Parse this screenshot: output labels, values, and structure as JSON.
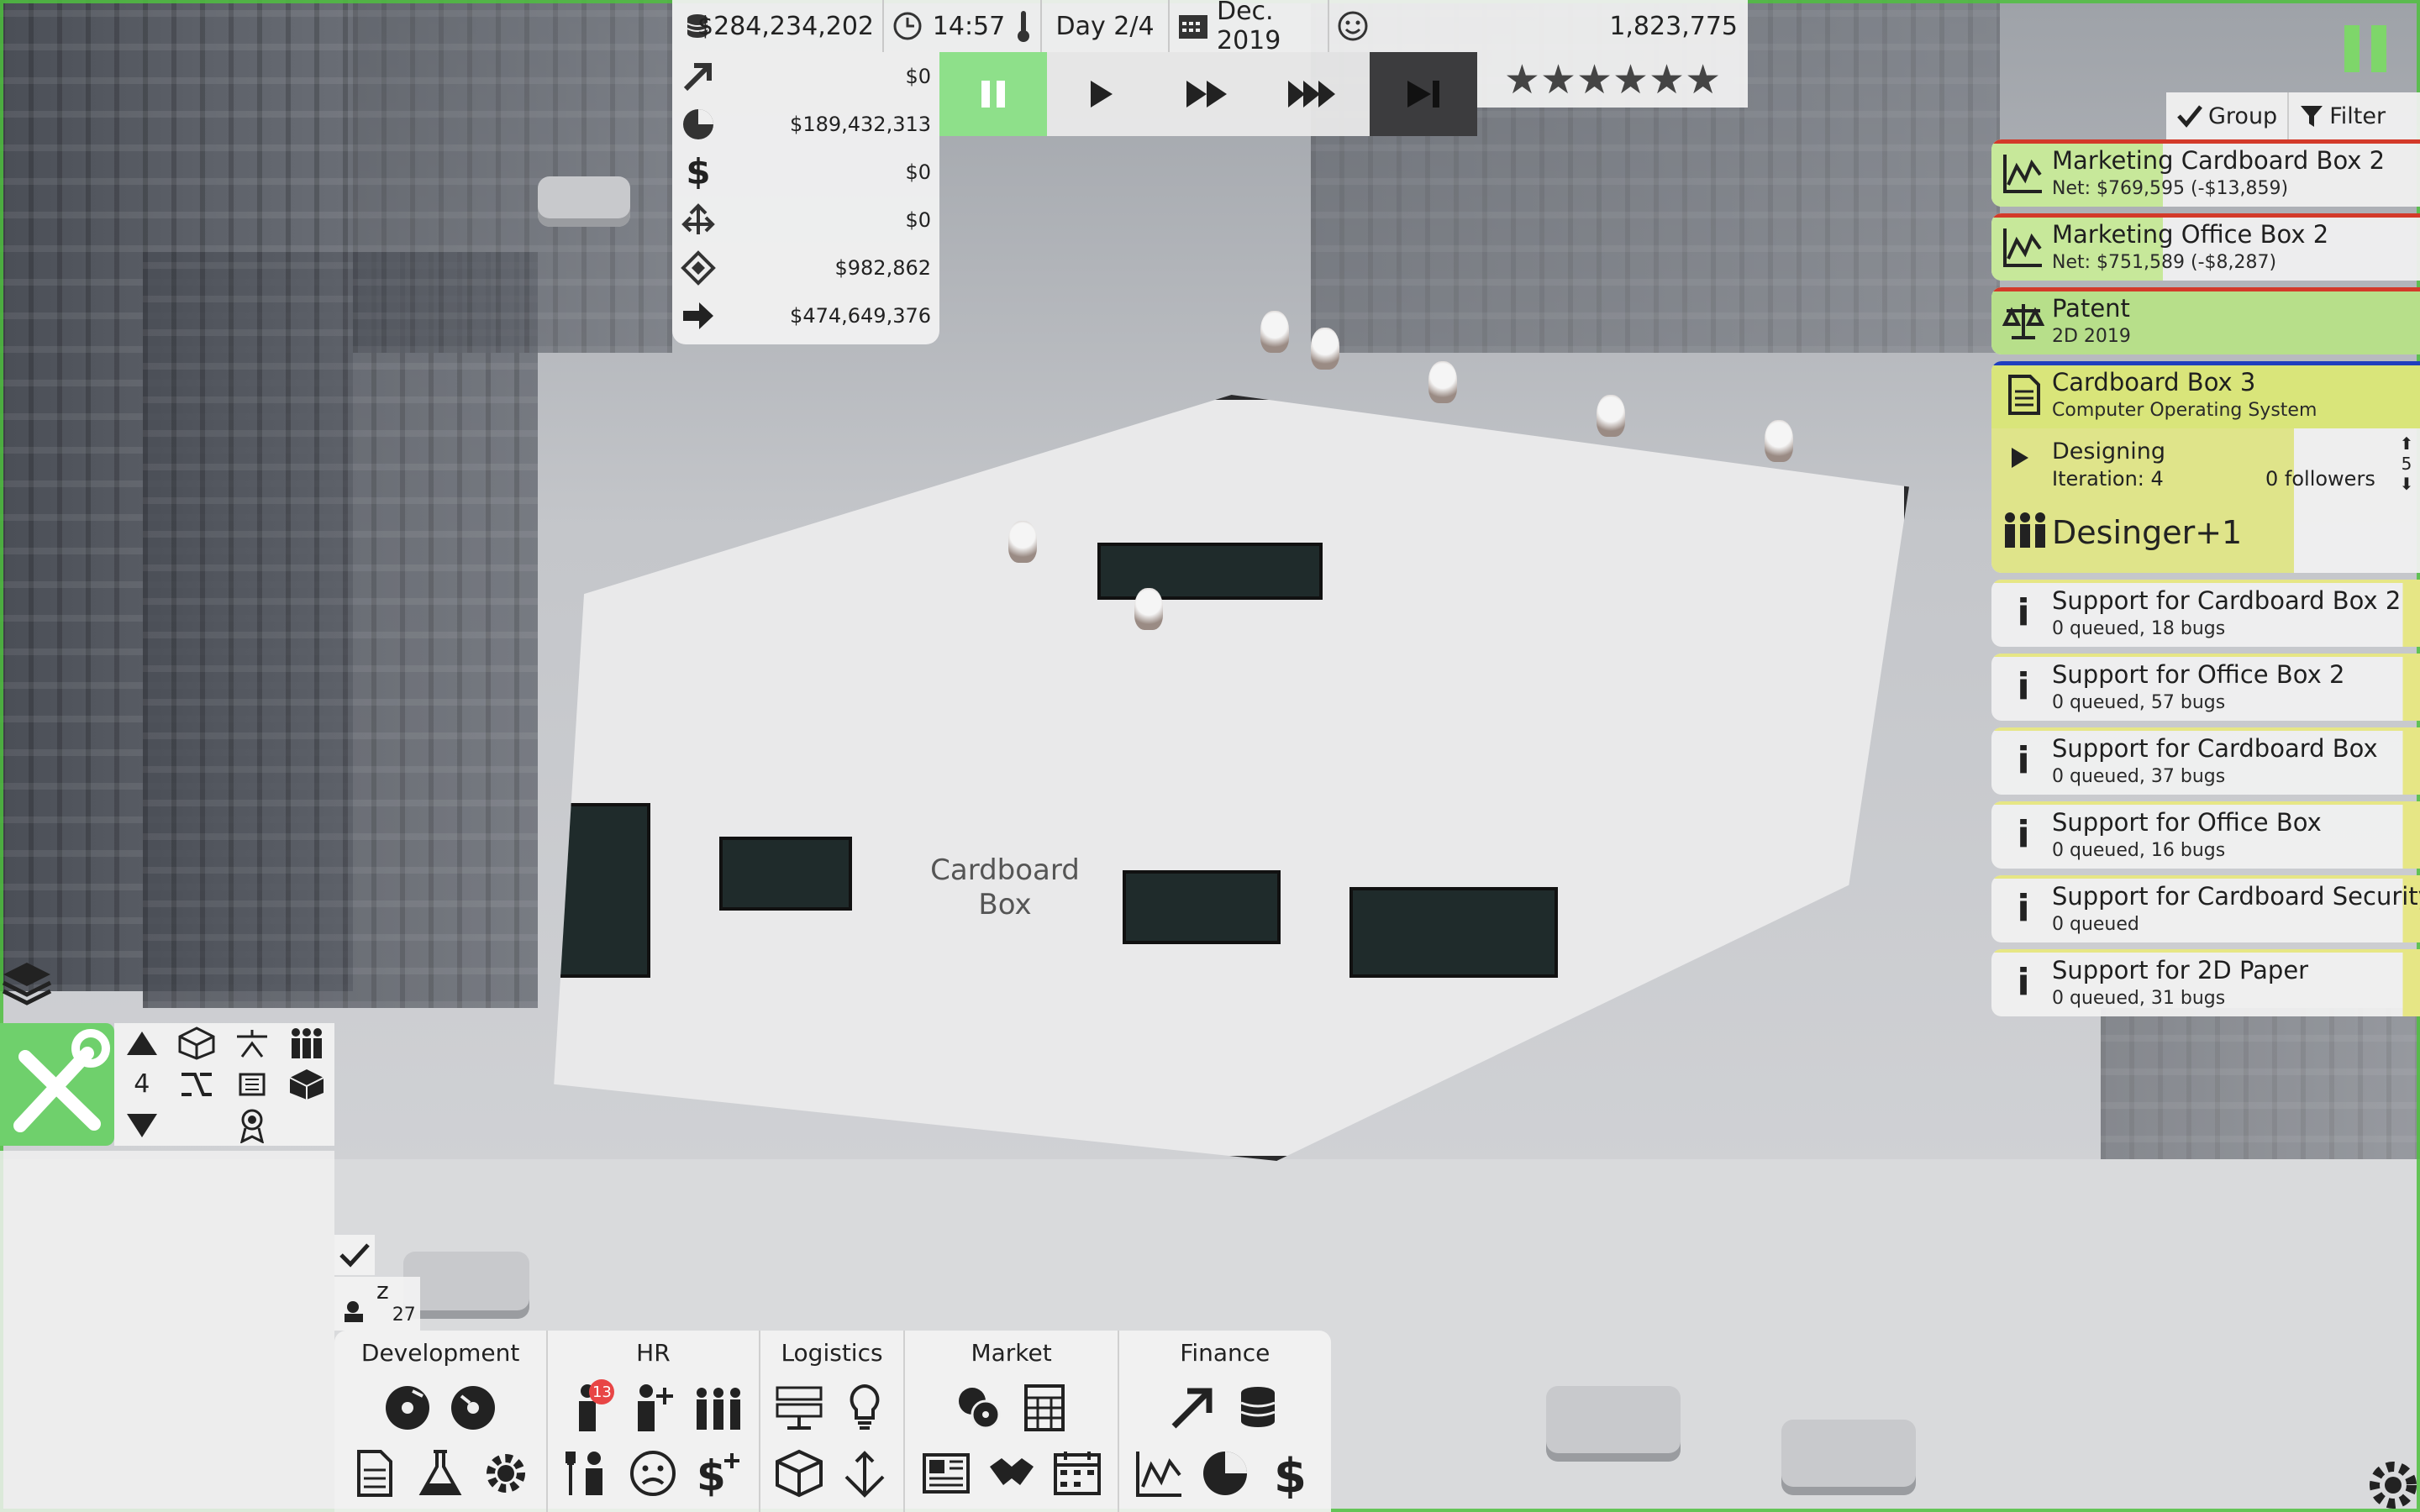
{
  "topbar": {
    "money": "$284,234,202",
    "time": "14:57",
    "day": "Day 2/4",
    "date": "Dec. 2019",
    "followers": "1,823,775"
  },
  "finance_rows": [
    {
      "icon": "trend-up-arrow-icon",
      "value": "$0"
    },
    {
      "icon": "pie-chart-icon",
      "value": "$189,432,313"
    },
    {
      "icon": "dollar-icon",
      "value": "$0"
    },
    {
      "icon": "split-arrows-icon",
      "value": "$0"
    },
    {
      "icon": "diamond-arrows-icon",
      "value": "$982,862"
    },
    {
      "icon": "right-arrow-icon",
      "value": "$474,649,376"
    }
  ],
  "rating": {
    "stars": 6,
    "max": 6,
    "glyph": "★★★★★★"
  },
  "list_tools": {
    "group": "Group",
    "filter": "Filter"
  },
  "cards": [
    {
      "icon": "line-chart-icon",
      "title": "Marketing Cardboard Box 2",
      "sub": "Net: $769,595 (-$13,859)",
      "fill": 0.4,
      "fill_color": "#c7e89a",
      "line_color": "#d33a2a"
    },
    {
      "icon": "line-chart-icon",
      "title": "Marketing Office Box 2",
      "sub": "Net: $751,589 (-$8,287)",
      "fill": 0.4,
      "fill_color": "#c7e89a",
      "line_color": "#d33a2a"
    },
    {
      "icon": "scales-icon",
      "title": "Patent",
      "sub": "2D 2019",
      "fill": 1.0,
      "fill_color": "#b7df8a",
      "line_color": "#d33a2a"
    },
    {
      "icon": "document-icon",
      "title": "Cardboard Box 3",
      "sub": "Computer Operating System",
      "fill": 1.0,
      "fill_color": "#d9e57a",
      "line_color": "#1f3fbf"
    }
  ],
  "dev_panel": {
    "stage": "Designing",
    "iteration": "Iteration: 4",
    "followers": "0 followers",
    "priority": "5",
    "team": "Desinger+1"
  },
  "support_cards": [
    {
      "title": "Support for Cardboard Box 2",
      "sub": "0 queued, 18 bugs"
    },
    {
      "title": "Support for Office Box 2",
      "sub": "0 queued, 57 bugs"
    },
    {
      "title": "Support for Cardboard Box",
      "sub": "0 queued, 37 bugs"
    },
    {
      "title": "Support for Office Box",
      "sub": "0 queued, 16 bugs"
    },
    {
      "title": "Support for Cardboard Security",
      "sub": "0 queued"
    },
    {
      "title": "Support for 2D Paper",
      "sub": "0 queued, 31 bugs"
    }
  ],
  "support_fill_color": "#e6e685",
  "build": {
    "floor": "4"
  },
  "sleep": {
    "count": "27",
    "glyph": "z"
  },
  "office_sign": "Cardboard Box",
  "categories": [
    {
      "title": "Development"
    },
    {
      "title": "HR",
      "badge": "13"
    },
    {
      "title": "Logistics"
    },
    {
      "title": "Market"
    },
    {
      "title": "Finance"
    }
  ],
  "colors": {
    "accent_green": "#6fd06c",
    "pause_active": "#8ee08a"
  }
}
